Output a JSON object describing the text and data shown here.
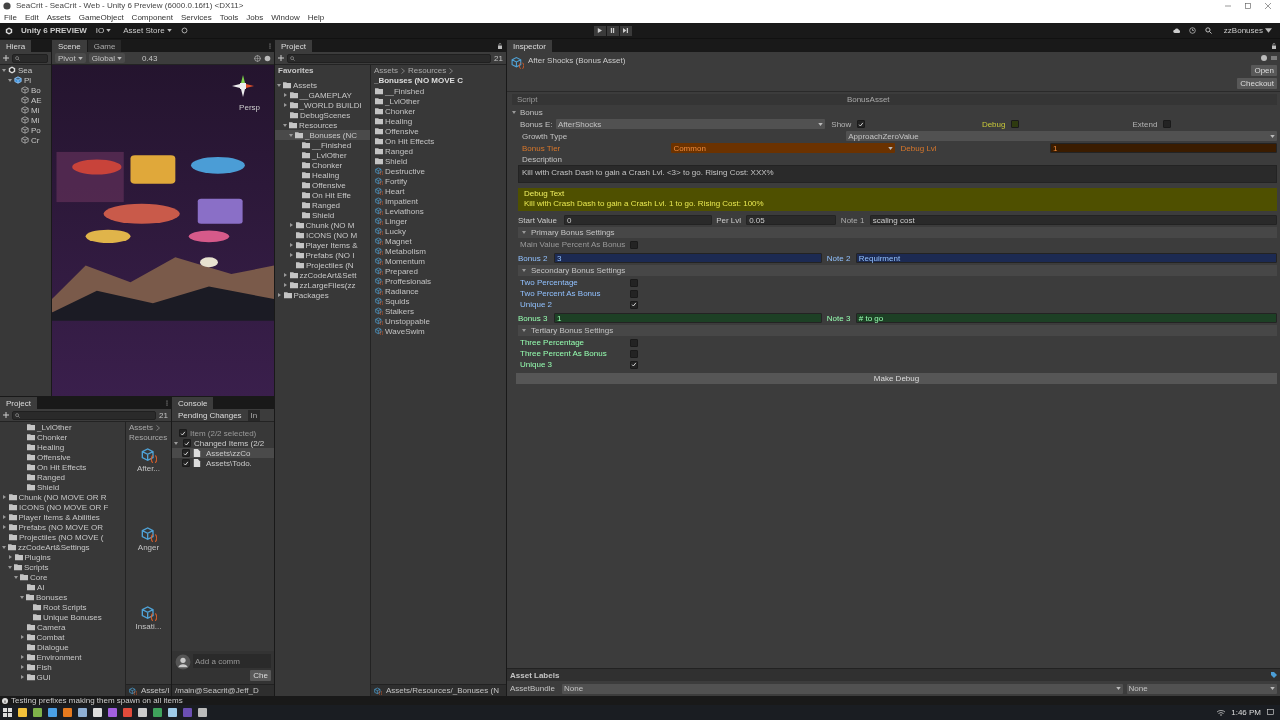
{
  "window": {
    "title": "SeaCrit - SeaCrit - Web - Unity 6 Preview (6000.0.16f1) <DX11>"
  },
  "menu": [
    "File",
    "Edit",
    "Assets",
    "GameObject",
    "Component",
    "Services",
    "Tools",
    "Jobs",
    "Window",
    "Help"
  ],
  "toolbar": {
    "brand": "Unity 6 PREVIEW",
    "account": "IO",
    "store": "Asset Store",
    "layout": "zzBonuses"
  },
  "hierarchy": {
    "tab": "Hiera",
    "items": [
      {
        "label": "Sea",
        "kind": "scene",
        "expanded": true,
        "children": [
          {
            "label": "Pl",
            "kind": "prefab",
            "expanded": true,
            "children": [
              {
                "label": "Bo",
                "kind": "object"
              },
              {
                "label": "AE",
                "kind": "object"
              },
              {
                "label": "Mi",
                "kind": "object"
              },
              {
                "label": "Mi",
                "kind": "object"
              },
              {
                "label": "Po",
                "kind": "object"
              },
              {
                "label": "Cr",
                "kind": "object"
              }
            ]
          }
        ]
      }
    ]
  },
  "scene": {
    "tabs": [
      {
        "label": "Scene",
        "selected": true
      },
      {
        "label": "Game",
        "selected": false
      }
    ],
    "pivot": "Pivot",
    "space": "Global",
    "zoom": "0.43",
    "camera": "Persp"
  },
  "project": {
    "tab": "Project",
    "count": "21",
    "favorites": "Favorites",
    "tree": [
      {
        "label": "Assets",
        "selected": false,
        "expanded": true,
        "children": [
          {
            "label": "__GAMEPLAY",
            "selected": false,
            "expanded": false
          },
          {
            "label": "_WORLD BUILDI",
            "selected": false,
            "expanded": false
          },
          {
            "label": "DebugScenes",
            "selected": false
          },
          {
            "label": "Resources",
            "selected": false,
            "expanded": true,
            "children": [
              {
                "label": "_Bonuses (NC",
                "selected": true,
                "expanded": true,
                "children": [
                  {
                    "label": "__Finished",
                    "selected": false
                  },
                  {
                    "label": "_LvlOther",
                    "selected": false
                  },
                  {
                    "label": "Chonker",
                    "selected": false
                  },
                  {
                    "label": "Healing",
                    "selected": false
                  },
                  {
                    "label": "Offensive",
                    "selected": false
                  },
                  {
                    "label": "On Hit Effe",
                    "selected": false
                  },
                  {
                    "label": "Ranged",
                    "selected": false
                  },
                  {
                    "label": "Shield",
                    "selected": false
                  }
                ]
              },
              {
                "label": "Chunk (NO M",
                "selected": false,
                "expanded": false
              },
              {
                "label": "ICONS (NO M",
                "selected": false
              },
              {
                "label": "Player Items &",
                "selected": false,
                "expanded": false
              },
              {
                "label": "Prefabs (NO I",
                "selected": false,
                "expanded": false
              },
              {
                "label": "Projectiles (N",
                "selected": false
              }
            ]
          },
          {
            "label": "zzCodeArt&Sett",
            "selected": false,
            "expanded": false
          },
          {
            "label": "zzLargeFiles(zz",
            "selected": false,
            "expanded": false
          }
        ]
      },
      {
        "label": "Packages",
        "selected": false,
        "expanded": false
      }
    ],
    "breadcrumb": [
      "Assets",
      "Resources",
      "_Bonuses (NO MOVE C"
    ],
    "items": [
      {
        "label": "__Finished",
        "kind": "folder"
      },
      {
        "label": "_LvlOther",
        "kind": "folder"
      },
      {
        "label": "Chonker",
        "kind": "folder"
      },
      {
        "label": "Healing",
        "kind": "folder"
      },
      {
        "label": "Offensive",
        "kind": "folder"
      },
      {
        "label": "On Hit Effects",
        "kind": "folder"
      },
      {
        "label": "Ranged",
        "kind": "folder"
      },
      {
        "label": "Shield",
        "kind": "folder"
      },
      {
        "label": "Destructive",
        "kind": "asset"
      },
      {
        "label": "Fortify",
        "kind": "asset"
      },
      {
        "label": "Heart",
        "kind": "asset"
      },
      {
        "label": "Impatient",
        "kind": "asset"
      },
      {
        "label": "Leviathons",
        "kind": "asset"
      },
      {
        "label": "Linger",
        "kind": "asset"
      },
      {
        "label": "Lucky",
        "kind": "asset"
      },
      {
        "label": "Magnet",
        "kind": "asset"
      },
      {
        "label": "Metabolism",
        "kind": "asset"
      },
      {
        "label": "Momentum",
        "kind": "asset"
      },
      {
        "label": "Prepared",
        "kind": "asset"
      },
      {
        "label": "Proffesionals",
        "kind": "asset"
      },
      {
        "label": "Radiance",
        "kind": "asset"
      },
      {
        "label": "Squids",
        "kind": "asset"
      },
      {
        "label": "Stalkers",
        "kind": "asset"
      },
      {
        "label": "Unstoppable",
        "kind": "asset"
      },
      {
        "label": "WaveSwim",
        "kind": "asset"
      }
    ],
    "path": "Assets/Resources/_Bonuses (N"
  },
  "project2": {
    "tab": "Project",
    "count": "21",
    "tree_tail": [
      {
        "label": "_LvlOther"
      },
      {
        "label": "Chonker"
      },
      {
        "label": "Healing"
      },
      {
        "label": "Offensive"
      },
      {
        "label": "On Hit Effects"
      },
      {
        "label": "Ranged"
      },
      {
        "label": "Shield"
      }
    ],
    "tree": [
      {
        "label": "Chunk (NO MOVE OR R",
        "expanded": false
      },
      {
        "label": "ICONS (NO MOVE OR F"
      },
      {
        "label": "Player Items & Abilities",
        "expanded": false
      },
      {
        "label": "Prefabs (NO MOVE OR",
        "expanded": false
      },
      {
        "label": "Projectiles (NO MOVE ("
      },
      {
        "label": "zzCodeArt&Settings",
        "expanded": true,
        "children": [
          {
            "label": "Plugins",
            "expanded": false
          },
          {
            "label": "Scripts",
            "expanded": true,
            "children": [
              {
                "label": "Core",
                "expanded": true,
                "children": [
                  {
                    "label": "AI"
                  },
                  {
                    "label": "Bonuses",
                    "expanded": true,
                    "children": [
                      {
                        "label": "Root Scripts"
                      },
                      {
                        "label": "Unique Bonuses"
                      }
                    ]
                  },
                  {
                    "label": "Camera"
                  },
                  {
                    "label": "Combat",
                    "expanded": false
                  },
                  {
                    "label": "Dialogue"
                  },
                  {
                    "label": "Environment",
                    "expanded": false
                  },
                  {
                    "label": "Fish",
                    "expanded": false
                  },
                  {
                    "label": "GUI",
                    "expanded": false
                  }
                ]
              }
            ]
          }
        ]
      }
    ],
    "breadcrumb": [
      "Assets",
      "Resources"
    ],
    "items": [
      "After...",
      "Anger",
      "Insati..."
    ],
    "path": "Assets/I"
  },
  "console": {
    "tab": "Console",
    "tabs": [
      {
        "label": "Pending Changes",
        "selected": true
      },
      {
        "label": "In",
        "selected": false
      }
    ],
    "items": [
      {
        "label": "Item (2/2 selected)",
        "kind": "header",
        "checked": true,
        "selected": false
      },
      {
        "label": "Changed Items (2/2",
        "kind": "group",
        "checked": true,
        "selected": false
      },
      {
        "label": "Assets\\zzCo",
        "kind": "file",
        "checked": true,
        "selected": true
      },
      {
        "label": "Assets\\Todo.",
        "kind": "file",
        "checked": true,
        "selected": false
      }
    ],
    "comment_placeholder": "Add a comm",
    "checkin": "Che",
    "branch": "/main@Seacrit@Jeff_D"
  },
  "inspector": {
    "tab": "Inspector",
    "title": "After Shocks (Bonus Asset)",
    "buttons": [
      "Open",
      "Checkout"
    ],
    "script": {
      "label": "Script",
      "value": "BonusAsset"
    },
    "section": "Bonus",
    "bonus_enum": {
      "label": "Bonus E:",
      "value": "AfterShocks"
    },
    "flags": [
      {
        "label": "Show",
        "checked": true,
        "kind": "plain"
      },
      {
        "label": "Debug",
        "checked": false,
        "kind": "debug"
      },
      {
        "label": "Extend",
        "checked": false,
        "kind": "plain"
      }
    ],
    "growth": {
      "label": "Growth Type",
      "value": "ApproachZeroValue"
    },
    "tier": {
      "label": "Bonus Tier",
      "value": "Common",
      "debug_label": "Debug Lvl",
      "debug_value": "1"
    },
    "description": {
      "label": "Description",
      "value": "Kill with Crash Dash to gain a Crash Lvl. <3> to go. Rising Cost: XXX%"
    },
    "debug_text": {
      "label": "Debug Text",
      "value": "Kill with Crash Dash to gain a Crash Lvl. 1 to go. Rising Cost: 100%"
    },
    "groups": [
      {
        "row": {
          "kind": "start",
          "label": "Start Value",
          "value": "0",
          "per_label": "Per Lvl",
          "per_value": "0.05",
          "note_label": "Note 1",
          "note": "scaling cost"
        },
        "settings": {
          "title": "Primary Bonus Settings",
          "expanded": true,
          "toggles": [
            {
              "label": "Main Value Percent As Bonus",
              "checked": false,
              "disabled": true
            }
          ]
        }
      },
      {
        "row": {
          "kind": "bonus",
          "label": "Bonus 2",
          "value": "3",
          "note_label": "Note 2",
          "note": "Requirment",
          "color": "#1c2a52"
        },
        "settings": {
          "title": "Secondary Bonus Settings",
          "expanded": true,
          "toggles": [
            {
              "label": "Two Percentage",
              "checked": false,
              "disabled": false
            },
            {
              "label": "Two Percent As Bonus",
              "checked": false,
              "disabled": false
            },
            {
              "label": "Unique 2",
              "checked": true,
              "disabled": false
            }
          ]
        }
      },
      {
        "row": {
          "kind": "bonus",
          "label": "Bonus 3",
          "value": "1",
          "note_label": "Note 3",
          "note": "# to go",
          "color": "#1d4025"
        },
        "settings": {
          "title": "Tertiary Bonus Settings",
          "expanded": true,
          "toggles": [
            {
              "label": "Three Percentage",
              "checked": false,
              "disabled": false
            },
            {
              "label": "Three Percent As Bonus",
              "checked": false,
              "disabled": false
            },
            {
              "label": "Unique 3",
              "checked": true,
              "disabled": false
            }
          ]
        }
      }
    ],
    "make_debug": "Make Debug",
    "asset_labels": "Asset Labels",
    "bundle_label": "AssetBundle",
    "bundle_values": [
      "None",
      "None"
    ]
  },
  "status": "Testing prefixes making them spawn on all items",
  "taskbar": {
    "time": "1:46 PM"
  }
}
